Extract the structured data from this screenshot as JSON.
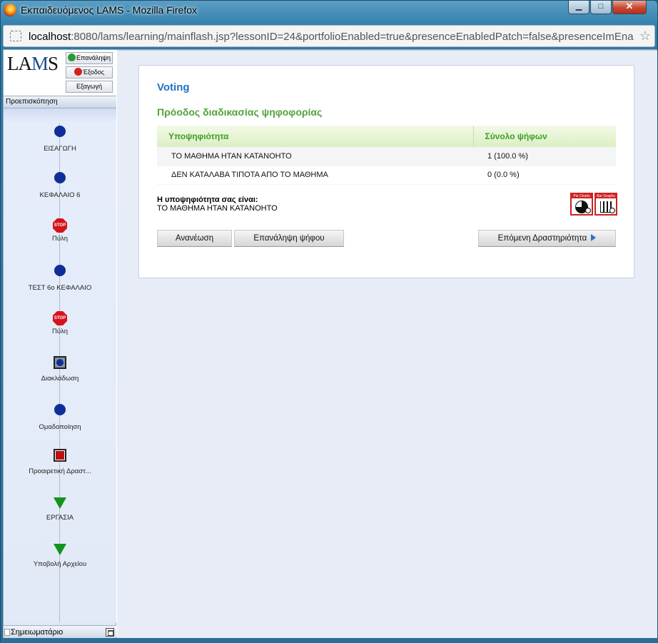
{
  "window": {
    "title": "Εκπαιδευόμενος LAMS - Mozilla Firefox",
    "controls": {
      "minimize": "▁",
      "maximize": "□",
      "close": "✕"
    }
  },
  "address_bar": {
    "host": "localhost",
    "rest": ":8080/lams/learning/mainflash.jsp?lessonID=24&portfolioEnabled=true&presenceEnabledPatch=false&presenceImEna"
  },
  "sidebar": {
    "logo_left": "LA",
    "logo_mid": "M",
    "logo_right": "S",
    "buttons": {
      "resume": "Επανάληψη",
      "exit": "Έξοδος",
      "export": "Εξαγωγή"
    },
    "preview_tab": "Προεπισκόπηση",
    "activities": [
      {
        "label": "ΕΙΣΑΓΩΓΗ",
        "icon": "completed-dot-icon"
      },
      {
        "label": "ΚΕΦΑΛΑΙΟ 6",
        "icon": "completed-dot-icon"
      },
      {
        "label": "Πύλη",
        "icon": "stop-gate-icon"
      },
      {
        "label": "ΤΕΣΤ 6ο ΚΕΦΑΛΑΙΟ",
        "icon": "completed-dot-icon"
      },
      {
        "label": "Πύλη",
        "icon": "stop-gate-icon"
      },
      {
        "label": "Διακλάδωση",
        "icon": "branching-icon"
      },
      {
        "label": "Ομαδοποίηση",
        "icon": "completed-dot-icon"
      },
      {
        "label": "Προαιρετική Δραστ...",
        "icon": "optional-activity-icon"
      },
      {
        "label": "ΕΡΓΑΣΙΑ",
        "icon": "current-triangle-icon"
      },
      {
        "label": "Υποβολή Αρχείου",
        "icon": "current-triangle-icon"
      }
    ],
    "stop_text": "STOP",
    "notebook": "Σημειωματάριο"
  },
  "voting": {
    "title": "Voting",
    "progress_heading": "Πρόοδος διαδικασίας ψηφοφορίας",
    "columns": [
      "Υποψηφιότητα",
      "Σύνολο ψήφων"
    ],
    "rows": [
      {
        "nomination": "ΤΟ ΜΑΘΗΜΑ ΗΤΑΝ ΚΑΤΑΝΟΗΤΟ",
        "votes": "1  (100.0 %)"
      },
      {
        "nomination": "ΔΕΝ ΚΑΤΑΛΑΒΑ ΤΙΠΟΤΑ ΑΠΟ ΤΟ ΜΑΘΗΜΑ",
        "votes": "0  (0.0 %)"
      }
    ],
    "your_choice_label": "Η υποψηφιότητα σας είναι:",
    "your_choice_value": "ΤΟ ΜΑΘΗΜΑ ΗΤΑΝ ΚΑΤΑΝΟΗΤΟ",
    "chart_icons": {
      "pie": "Pie Charts",
      "bar": "Bar Graphs"
    },
    "buttons": {
      "refresh": "Ανανέωση",
      "revote": "Επανάληψη ψήφου",
      "next": "Επόμενη Δραστηριότητα"
    }
  },
  "colors": {
    "title_blue": "#1f73c4",
    "heading_green": "#52a33c",
    "header_green": "#3b9e24"
  }
}
